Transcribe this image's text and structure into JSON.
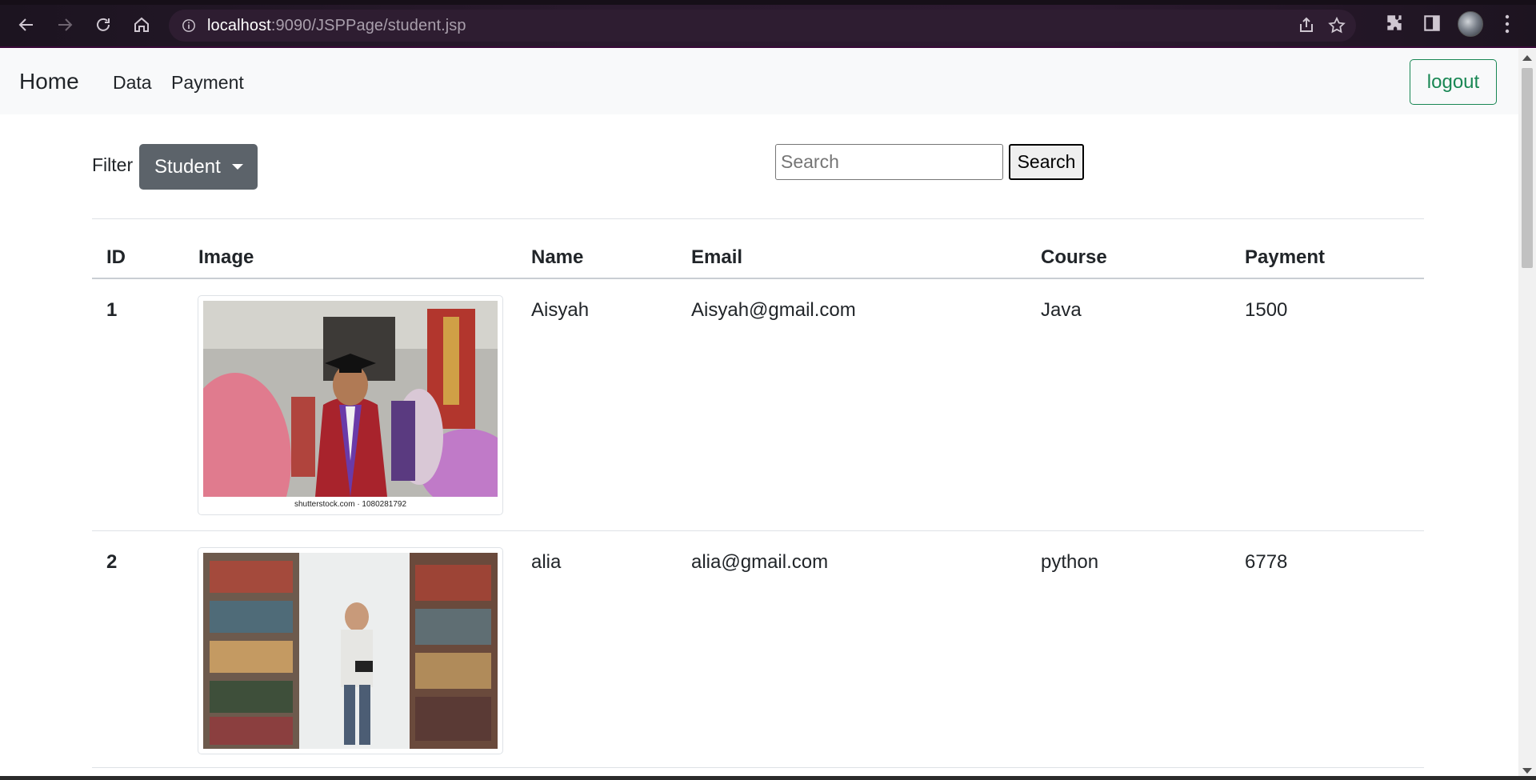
{
  "browser": {
    "url_host": "localhost",
    "url_path": ":9090/JSPPage/student.jsp"
  },
  "navbar": {
    "brand": "Home",
    "links": [
      "Data",
      "Payment"
    ],
    "logout_label": "logout"
  },
  "filter": {
    "label": "Filter",
    "selected": "Student"
  },
  "search": {
    "placeholder": "Search",
    "button_label": "Search"
  },
  "table": {
    "headers": [
      "ID",
      "Image",
      "Name",
      "Email",
      "Course",
      "Payment"
    ],
    "rows": [
      {
        "id": "1",
        "image": "graduate-photo",
        "image_caption": "shutterstock.com · 1080281792",
        "name": "Aisyah",
        "email": "Aisyah@gmail.com",
        "course": "Java",
        "payment": "1500"
      },
      {
        "id": "2",
        "image": "library-student-photo",
        "image_caption": "",
        "name": "alia",
        "email": "alia@gmail.com",
        "course": "python",
        "payment": "6778"
      }
    ]
  }
}
